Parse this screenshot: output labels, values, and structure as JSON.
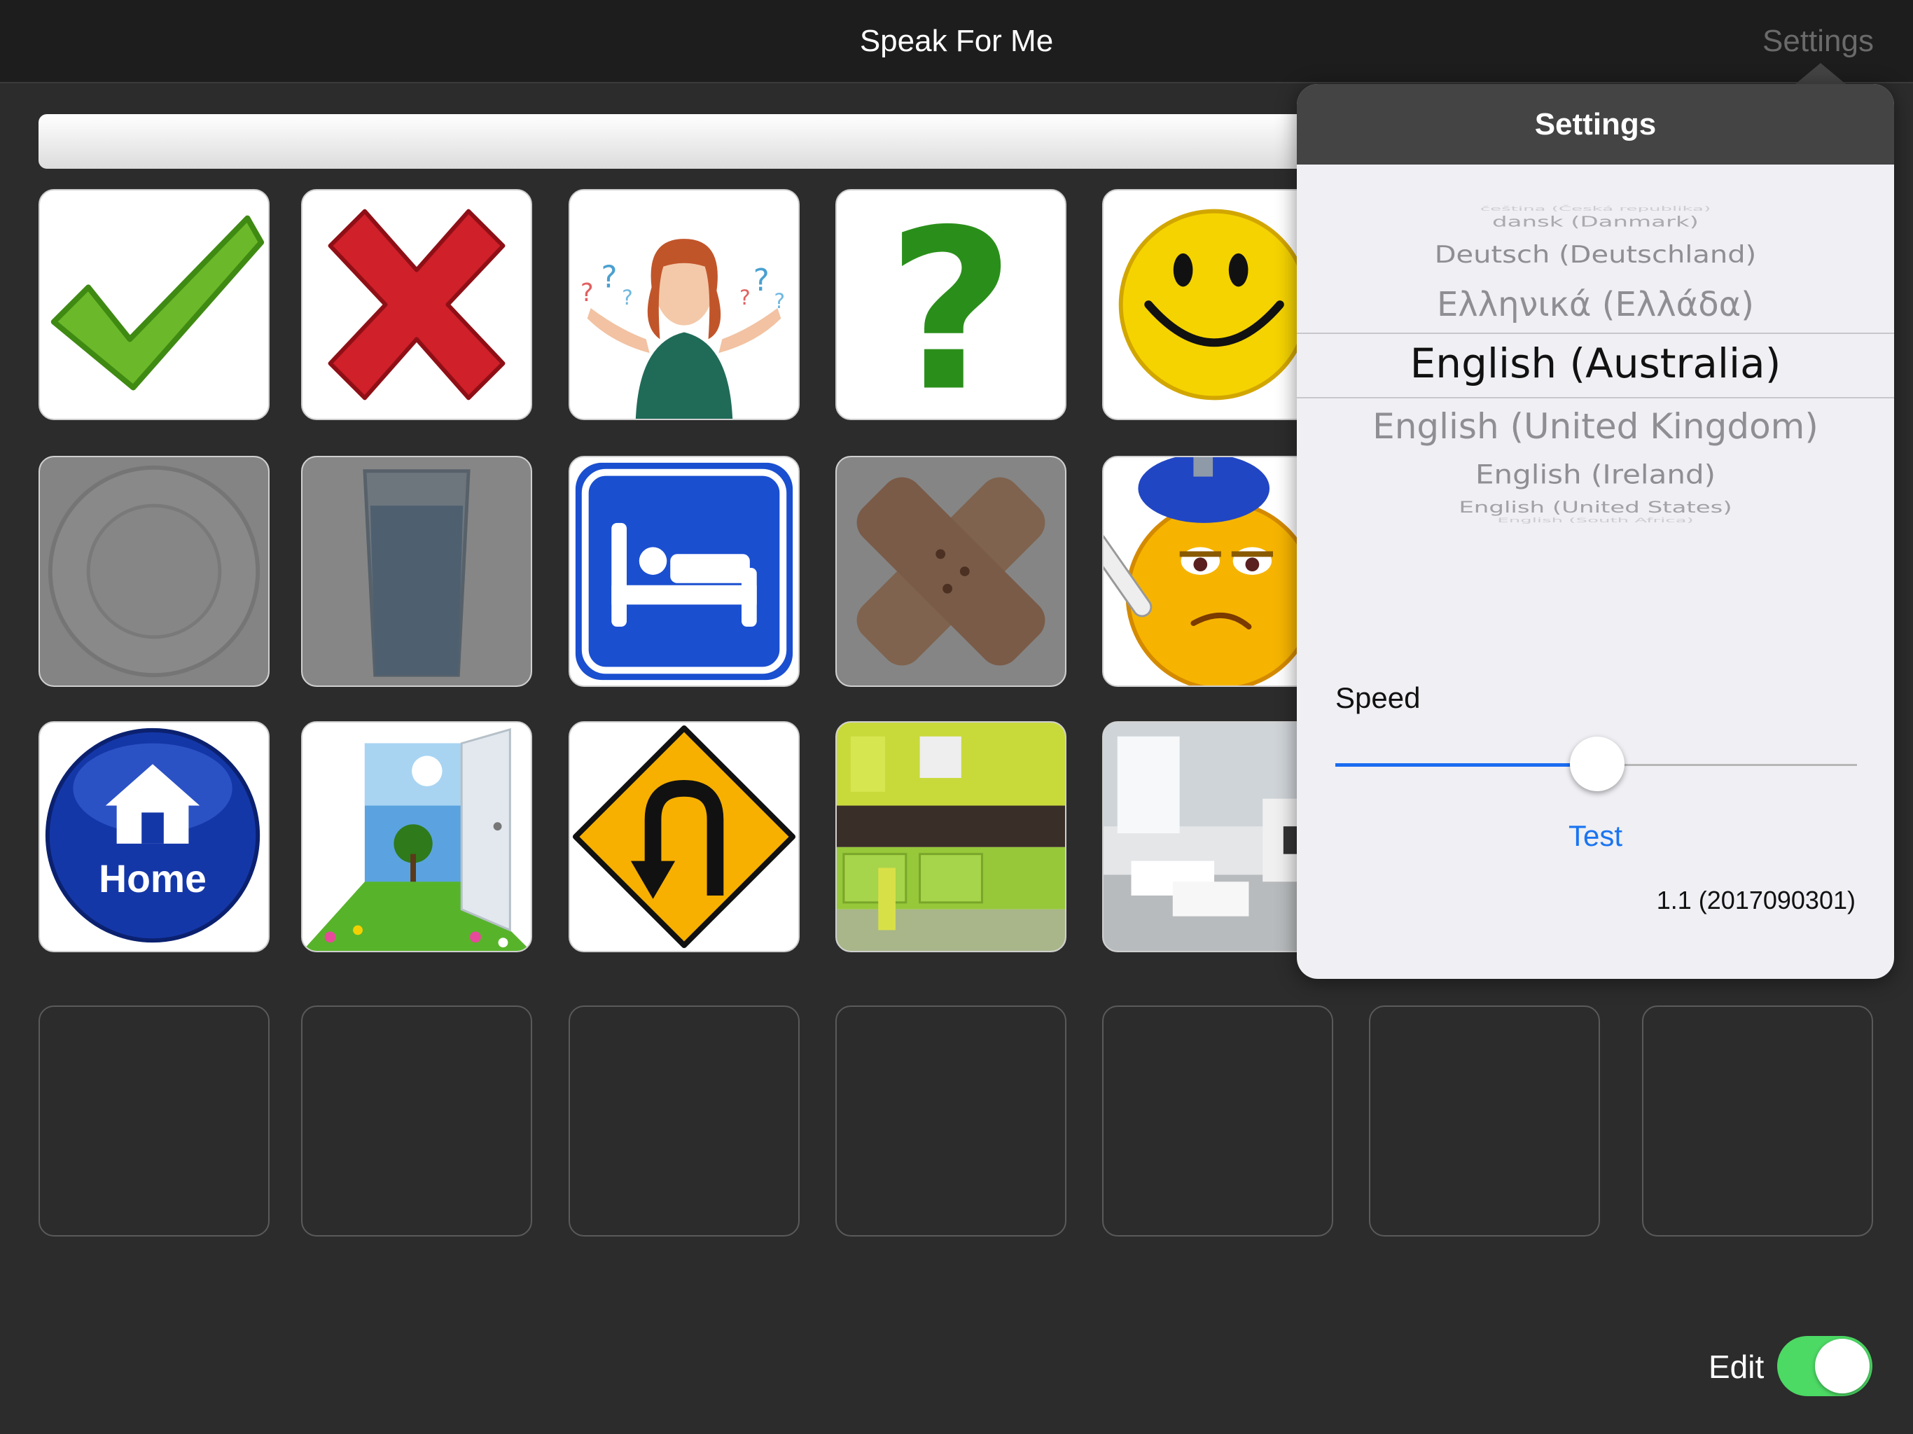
{
  "navbar": {
    "title": "Speak For Me",
    "settings_label": "Settings"
  },
  "tiles": {
    "home_label": "Home"
  },
  "settings_popover": {
    "title": "Settings",
    "languages": [
      "čeština (Česká republika)",
      "dansk (Danmark)",
      "Deutsch (Deutschland)",
      "Ελληνικά (Ελλάδα)",
      "English (Australia)",
      "English (United Kingdom)",
      "English (Ireland)",
      "English (United States)",
      "English (South Africa)"
    ],
    "selected_language": "English (Australia)",
    "speed_label": "Speed",
    "speed_value": 0.5,
    "test_label": "Test",
    "version": "1.1 (2017090301)"
  },
  "edit": {
    "label": "Edit",
    "on": true
  },
  "colors": {
    "accent": "#1a74f0",
    "toggle_on": "#4cd964",
    "navbar": "#1d1d1d",
    "background": "#2c2c2c"
  }
}
